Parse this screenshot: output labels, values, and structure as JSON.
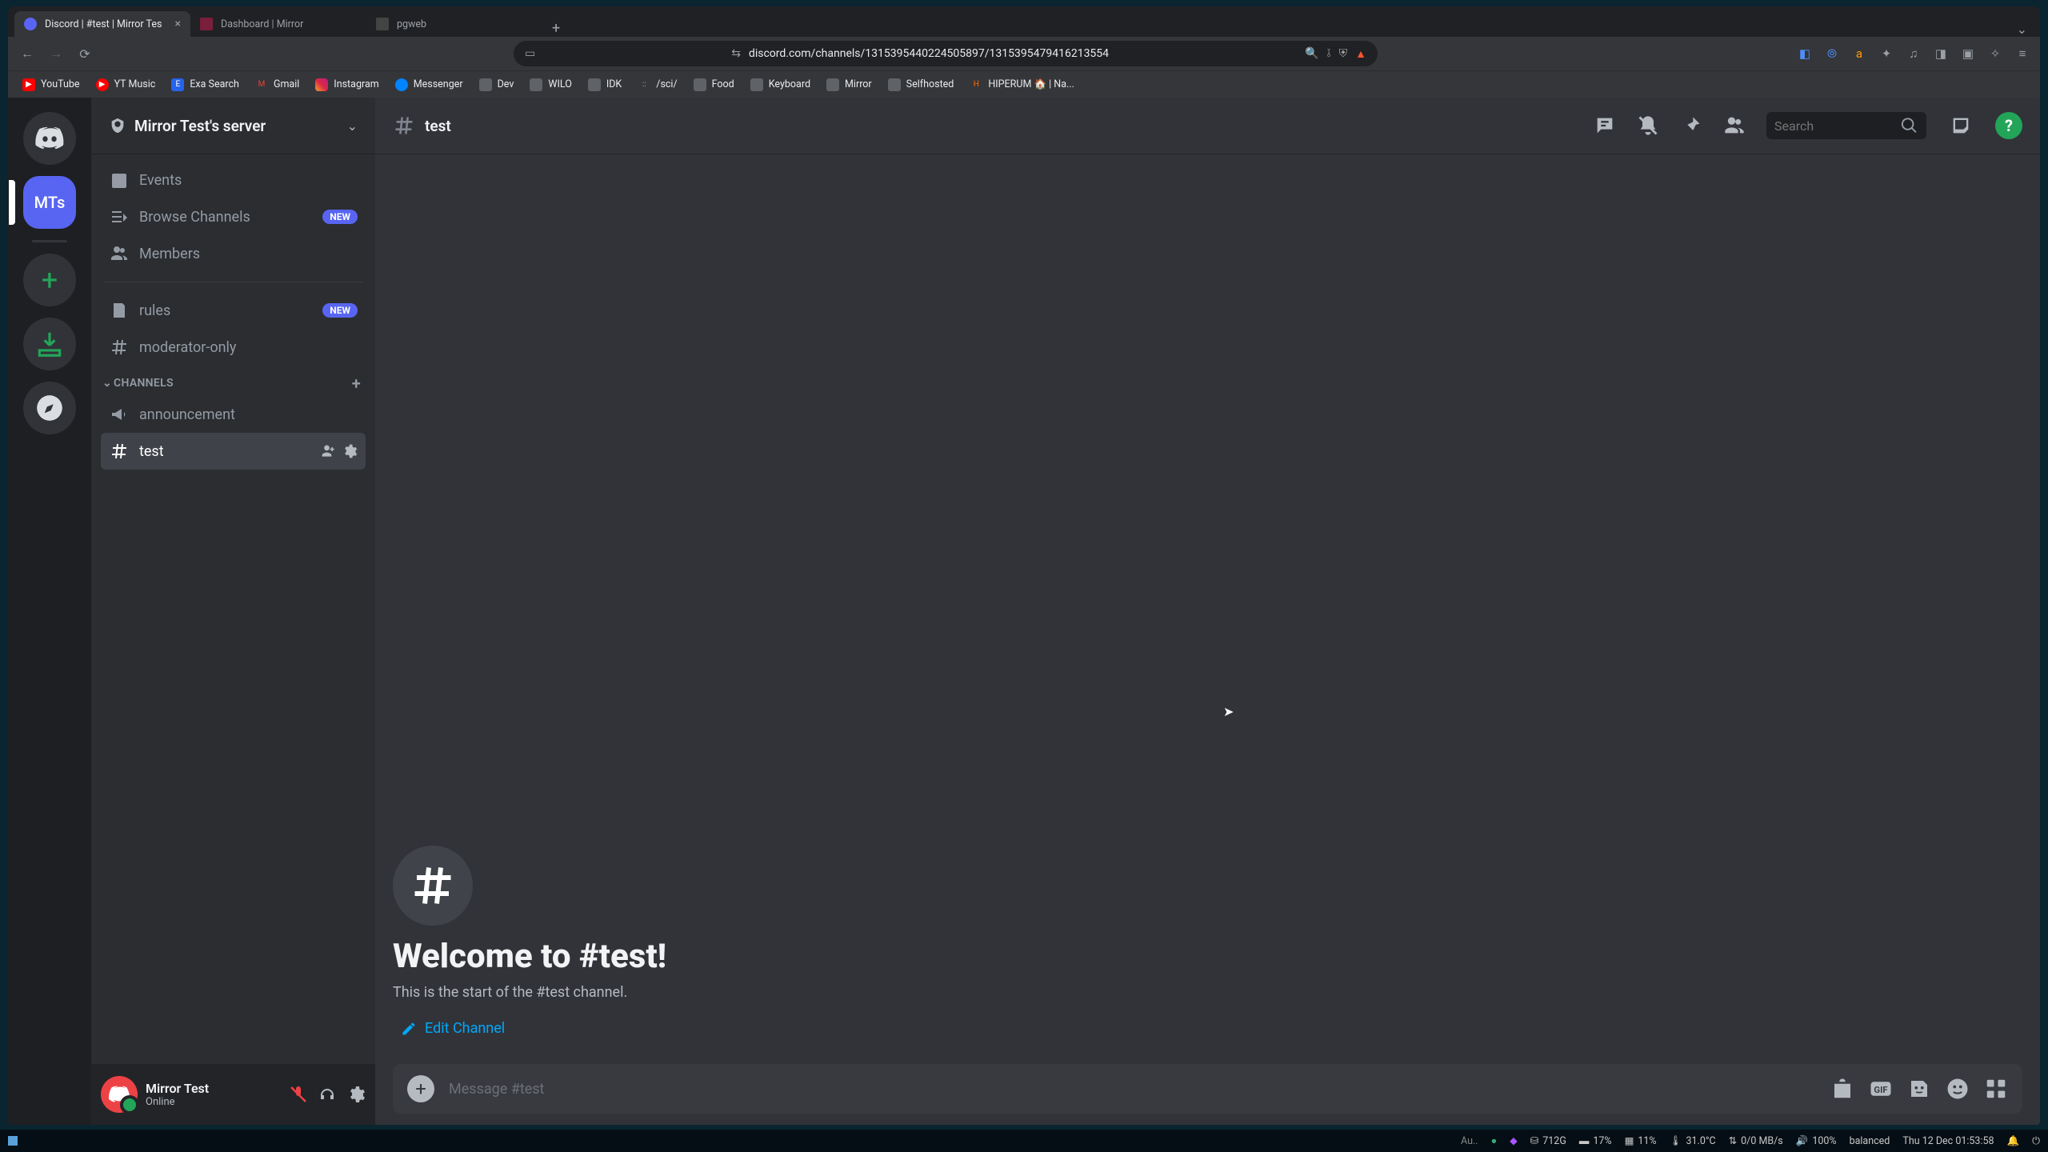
{
  "browser": {
    "tabs": [
      {
        "title": "Discord | #test | Mirror Tes",
        "active": true
      },
      {
        "title": "Dashboard | Mirror",
        "active": false
      },
      {
        "title": "pgweb",
        "active": false
      }
    ],
    "url": "discord.com/channels/1315395440224505897/1315395479416213554",
    "bookmarks": [
      "YouTube",
      "YT Music",
      "Exa Search",
      "Gmail",
      "Instagram",
      "Messenger",
      "Dev",
      "WILO",
      "IDK",
      "/sci/",
      "Food",
      "Keyboard",
      "Mirror",
      "Selfhosted",
      "HIPERUM 🏠 | Na..."
    ]
  },
  "discord": {
    "server_rail": {
      "selected": "MTs"
    },
    "server_name": "Mirror Test's server",
    "sidebar": {
      "top": [
        {
          "icon": "calendar",
          "label": "Events",
          "badge": null
        },
        {
          "icon": "browse",
          "label": "Browse Channels",
          "badge": "NEW"
        },
        {
          "icon": "members",
          "label": "Members",
          "badge": null
        }
      ],
      "special": [
        {
          "icon": "rules",
          "label": "rules",
          "badge": "NEW"
        },
        {
          "icon": "hash",
          "label": "moderator-only",
          "badge": null
        }
      ],
      "category_label": "CHANNELS",
      "channels": [
        {
          "icon": "megaphone",
          "label": "announcement",
          "selected": false
        },
        {
          "icon": "hash",
          "label": "test",
          "selected": true
        }
      ]
    },
    "user": {
      "name": "Mirror Test",
      "status": "Online"
    },
    "chat": {
      "channel_name": "test",
      "search_placeholder": "Search",
      "welcome_title": "Welcome to #test!",
      "welcome_sub": "This is the start of the #test channel.",
      "edit_label": "Edit Channel",
      "compose_placeholder": "Message #test"
    }
  },
  "taskbar": {
    "stats": {
      "disk": "712G",
      "mem": "17%",
      "cpu": "11%",
      "temp": "31.0°C",
      "net": "0/0 MB/s",
      "vol": "100%",
      "mode": "balanced",
      "clock": "Thu 12 Dec 01:53:58"
    }
  }
}
